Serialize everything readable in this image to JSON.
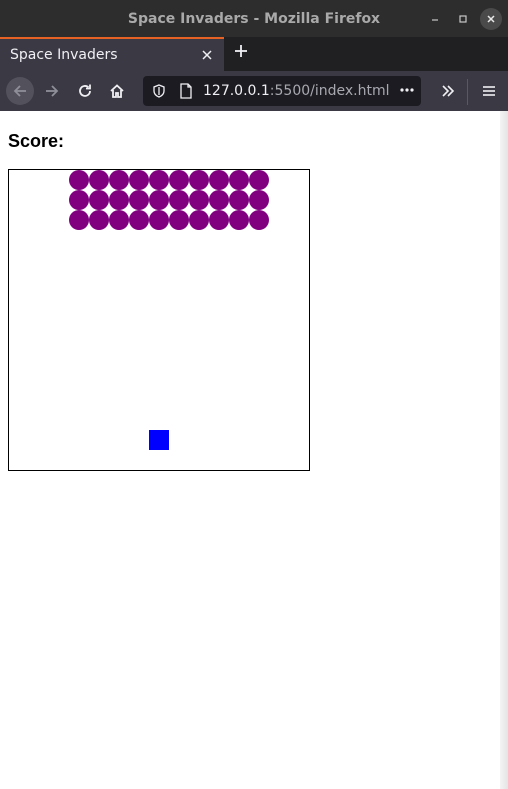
{
  "window": {
    "title": "Space Invaders - Mozilla Firefox"
  },
  "tabs": [
    {
      "label": "Space Invaders",
      "active": true
    }
  ],
  "navbar": {
    "url_host": "127.0.0.1",
    "url_rest": ":5500/index.html"
  },
  "page": {
    "score_label": "Score:"
  },
  "game": {
    "invader_rows": 3,
    "invader_cols": 10,
    "invader_color": "#800080",
    "player_color": "#0000ff"
  }
}
